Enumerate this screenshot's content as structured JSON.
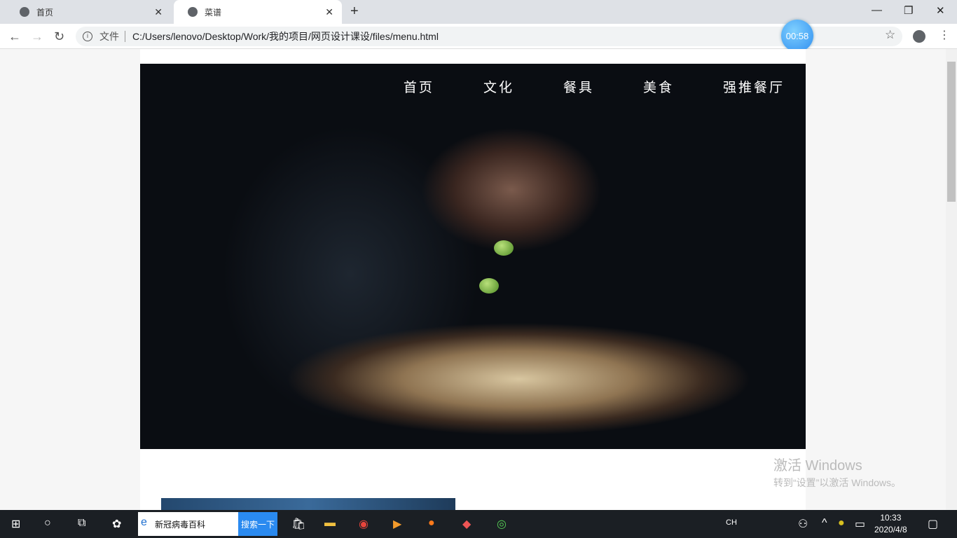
{
  "browser": {
    "tabs": [
      {
        "title": "首页",
        "active": false
      },
      {
        "title": "菜谱",
        "active": true
      }
    ],
    "address_label": "文件",
    "url": "C:/Users/lenovo/Desktop/Work/我的项目/网页设计课设/files/menu.html",
    "timer": "00:58"
  },
  "page": {
    "nav": [
      "首页",
      "文化",
      "餐具",
      "美食",
      "强推餐厅"
    ]
  },
  "watermark": {
    "line1": "激活 Windows",
    "line2": "转到“设置”以激活 Windows。"
  },
  "taskbar": {
    "search_text": "新冠病毒百科",
    "search_button": "搜索一下",
    "ime": "CH",
    "time": "10:33",
    "date": "2020/4/8"
  }
}
